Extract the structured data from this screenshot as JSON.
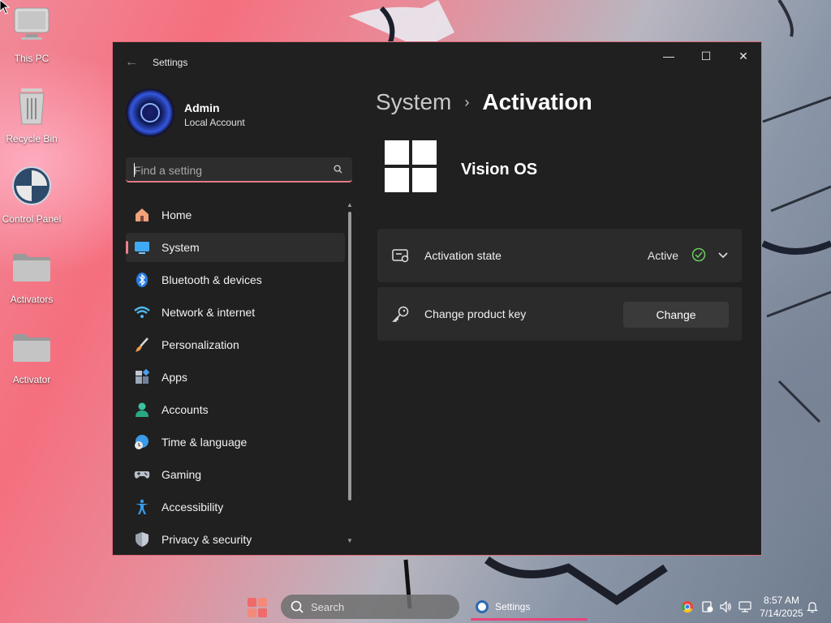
{
  "desktop": {
    "icons": [
      {
        "label": "This PC"
      },
      {
        "label": "Recycle Bin"
      },
      {
        "label": "Control Panel"
      },
      {
        "label": "Activators"
      },
      {
        "label": "Activator"
      }
    ]
  },
  "window": {
    "title": "Settings",
    "controls": {
      "minimize": "—",
      "maximize": "☐",
      "close": "✕"
    }
  },
  "profile": {
    "name": "Admin",
    "account_type": "Local Account"
  },
  "search": {
    "placeholder": "Find a setting"
  },
  "nav": {
    "items": [
      {
        "label": "Home",
        "icon": "home-icon"
      },
      {
        "label": "System",
        "icon": "system-icon",
        "active": true
      },
      {
        "label": "Bluetooth & devices",
        "icon": "bluetooth-icon"
      },
      {
        "label": "Network & internet",
        "icon": "wifi-icon"
      },
      {
        "label": "Personalization",
        "icon": "brush-icon"
      },
      {
        "label": "Apps",
        "icon": "apps-icon"
      },
      {
        "label": "Accounts",
        "icon": "accounts-icon"
      },
      {
        "label": "Time & language",
        "icon": "time-icon"
      },
      {
        "label": "Gaming",
        "icon": "gamepad-icon"
      },
      {
        "label": "Accessibility",
        "icon": "accessibility-icon"
      },
      {
        "label": "Privacy & security",
        "icon": "shield-icon"
      }
    ]
  },
  "main": {
    "breadcrumb_parent": "System",
    "breadcrumb_separator": "›",
    "breadcrumb_current": "Activation",
    "os_name": "Vision OS",
    "activation_state": {
      "label": "Activation state",
      "value": "Active"
    },
    "product_key": {
      "label": "Change product key",
      "button": "Change"
    }
  },
  "taskbar": {
    "search_label": "Search",
    "app_label": "Settings",
    "time": "8:57 AM",
    "date": "7/14/2025"
  },
  "colors": {
    "accent": "#e8848f",
    "window_bg": "#202020",
    "card_bg": "#2b2b2b",
    "active_green": "#6ccb5f"
  }
}
